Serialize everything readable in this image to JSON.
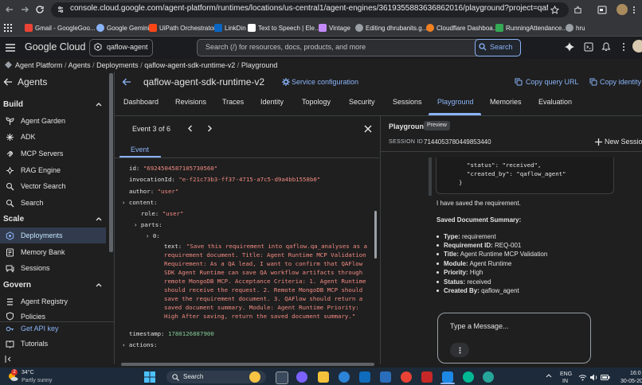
{
  "browser": {
    "url": "console.cloud.google.com/agent-platform/runtimes/locations/us-central1/agent-engines/3619355883636862016/playground?project=qaflow-agent&session=7144053...",
    "bookmarks": [
      "Gmail - GoogleGoo...",
      "Google Gemini",
      "UiPath Orchestrator",
      "LinkDin",
      "Text to Speech | Ele...",
      "Vintage",
      "Editing dhrubanits.g...",
      "Cloudflare Dashboa...",
      "RunningAttendance...",
      "hru"
    ]
  },
  "console": {
    "brand": "Google Cloud",
    "project": "qaflow-agent",
    "search_placeholder": "Search (/) for resources, docs, products, and more",
    "search_button": "Search"
  },
  "breadcrumb": [
    "Agent Platform",
    "Agents",
    "Deployments",
    "qaflow-agent-sdk-runtime-v2",
    "Playground"
  ],
  "leftnav": {
    "title": "Agents",
    "sections": [
      {
        "label": "Build",
        "items": [
          "Agent Garden",
          "ADK",
          "MCP Servers",
          "RAG Engine",
          "Vector Search",
          "Search"
        ]
      },
      {
        "label": "Scale",
        "items": [
          "Deployments",
          "Memory Bank",
          "Sessions"
        ]
      },
      {
        "label": "Govern",
        "items": [
          "Agent Registry",
          "Policies"
        ]
      }
    ],
    "footer": [
      "Get API key",
      "Tutorials"
    ]
  },
  "main": {
    "title": "qaflow-agent-sdk-runtime-v2",
    "service_config": "Service configuration",
    "copy_query_url": "Copy query URL",
    "copy_identity": "Copy identity",
    "tabs": [
      "Dashboard",
      "Revisions",
      "Traces",
      "Identity",
      "Topology",
      "Security",
      "Sessions",
      "Playground",
      "Memories",
      "Evaluation"
    ],
    "active_tab": "Playground"
  },
  "event_panel": {
    "counter": "Event 3 of 6",
    "tab": "Event",
    "id_key": "id:",
    "id_val": "\"6924504587105730560\"",
    "invocation_key": "invocationId:",
    "invocation_val": "\"e-f21c73b3-ff37-4715-a7c5-d9a4bb1558b0\"",
    "author_key": "author:",
    "author_val": "\"user\"",
    "content_key": "content:",
    "role_key": "role:",
    "role_val": "\"user\"",
    "parts_key": "parts:",
    "index_key": "0:",
    "text_key": "text:",
    "text_val": "\"Save this requirement into qaflow.qa_analyses as a requirement document. Title: Agent Runtime MCP Validation Requirement: As a QA lead, I want to confirm that QAFlow SDK Agent Runtime can save QA workflow artifacts through remote MongoDB MCP. Acceptance Criteria: 1. Agent Runtime should receive the request. 2. Remote MongoDB MCP should save the requirement document. 3. QAFlow should return a saved document summary. Module: Agent Runtime Priority: High After saving, return the saved document summary.\"",
    "timestamp_key": "timestamp:",
    "timestamp_val": "1780126887900",
    "actions_key": "actions:"
  },
  "playground": {
    "title": "Playground",
    "badge": "Preview",
    "session_label": "SESSION ID",
    "session_id": "7144053780449853440",
    "new_session": "New Session",
    "json_lines": [
      "\"status\": \"received\",",
      "\"created_by\": \"qaflow_agent\"",
      "}"
    ],
    "saved_msg": "I have saved the requirement.",
    "summary_title": "Saved Document Summary:",
    "summary": [
      {
        "key": "Type:",
        "val": "requirement"
      },
      {
        "key": "Requirement ID:",
        "val": "REQ-001"
      },
      {
        "key": "Title:",
        "val": "Agent Runtime MCP Validation"
      },
      {
        "key": "Module:",
        "val": "Agent Runtime"
      },
      {
        "key": "Priority:",
        "val": "High"
      },
      {
        "key": "Status:",
        "val": "received"
      },
      {
        "key": "Created By:",
        "val": "qaflow_agent"
      }
    ],
    "input_placeholder": "Type a Message..."
  },
  "taskbar": {
    "temp": "34°C",
    "weather": "Partly sunny",
    "badge": "2",
    "search": "Search",
    "lang_top": "ENG",
    "lang_bottom": "IN",
    "time": "16:0",
    "date": "30-05-202"
  },
  "colors": {
    "accent": "#8ab4f8",
    "string": "#f28b82",
    "number": "#81c995",
    "bg": "#1f1f1f"
  }
}
